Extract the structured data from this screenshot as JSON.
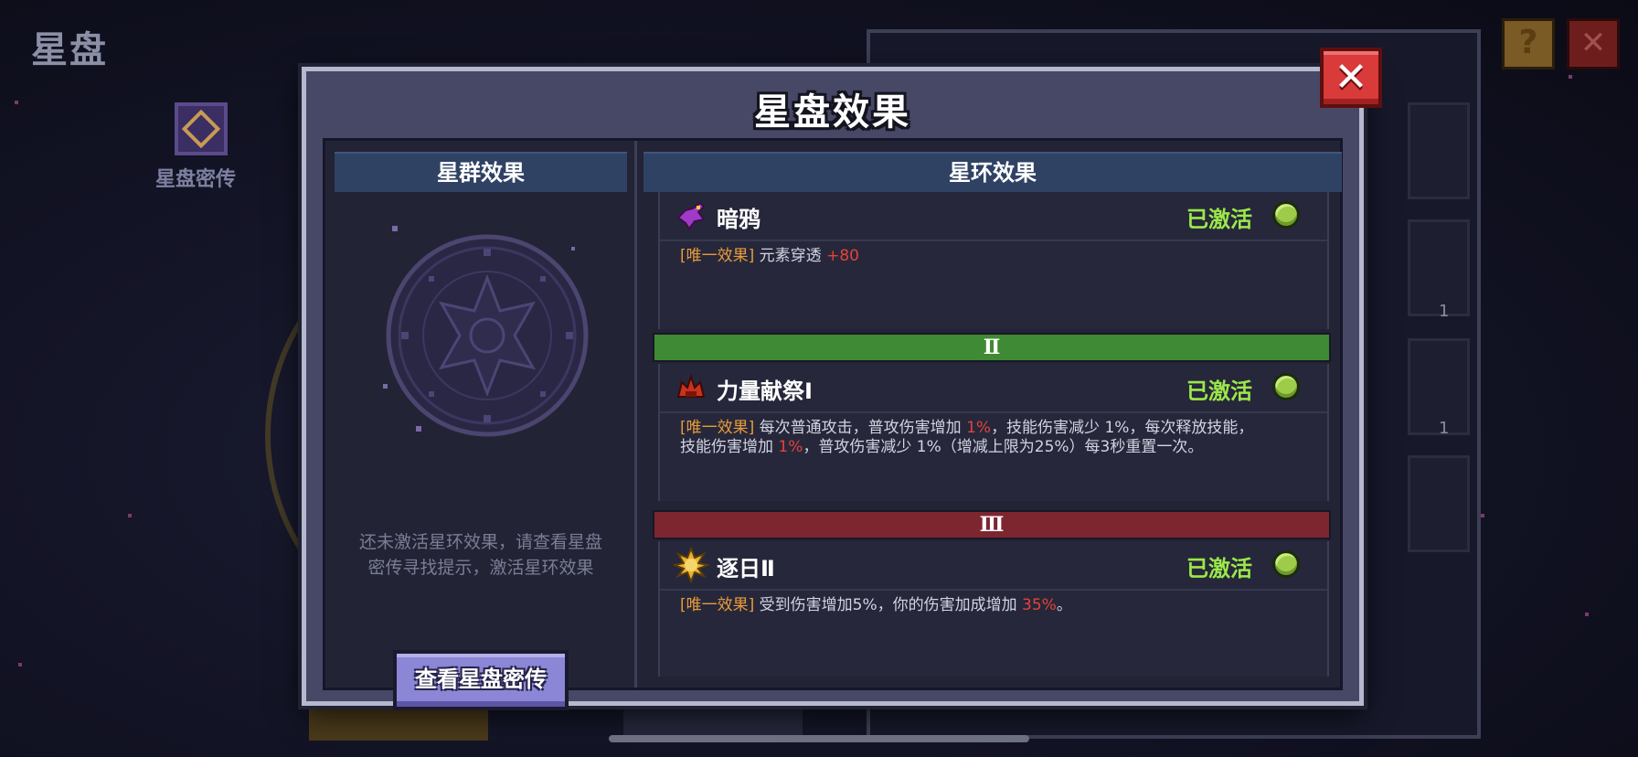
{
  "background": {
    "page_title": "星盘",
    "secret_label": "星盘密传",
    "slot_counts": [
      "1",
      "1"
    ]
  },
  "modal": {
    "title": "星盘效果",
    "close_label": "✕",
    "left": {
      "header": "星群效果",
      "hint_line1": "还未激活星环效果，请查看星盘",
      "hint_line2": "密传寻找提示，激活星环效果",
      "button": "查看星盘密传"
    },
    "right": {
      "header": "星环效果",
      "tiers": [
        "Ⅱ",
        "Ⅲ"
      ],
      "rings": [
        {
          "name": "暗鸦",
          "status": "已激活",
          "icon": "crow-icon",
          "tag": "[唯一效果]",
          "d1": " 元素穿透 ",
          "h1": "+80"
        },
        {
          "name": "力量献祭Ⅰ",
          "status": "已激活",
          "icon": "sacrifice-icon",
          "tag": "[唯一效果]",
          "d1": " 每次普通攻击，普攻伤害增加 ",
          "h1": "1%",
          "d2": "，技能伤害减少 1%，每次释放技能，",
          "d3": "技能伤害增加 ",
          "h2": "1%",
          "d4": "，普攻伤害减少 1%（增减上限为25%）每3秒重置一次。"
        },
        {
          "name": "逐日Ⅱ",
          "status": "已激活",
          "icon": "sun-icon",
          "tag": "[唯一效果]",
          "d1": " 受到伤害增加5%，你的伤害加成增加 ",
          "h1": "35%",
          "d2": "。"
        }
      ]
    }
  },
  "colors": {
    "status_green": "#9be84a",
    "tag_orange": "#e89b3a",
    "highlight_red": "#e5423a",
    "tier2_green": "#3f8a34",
    "tier3_red": "#7d2630",
    "close_red": "#d93a3a",
    "button_purple": "#8c86d6"
  }
}
